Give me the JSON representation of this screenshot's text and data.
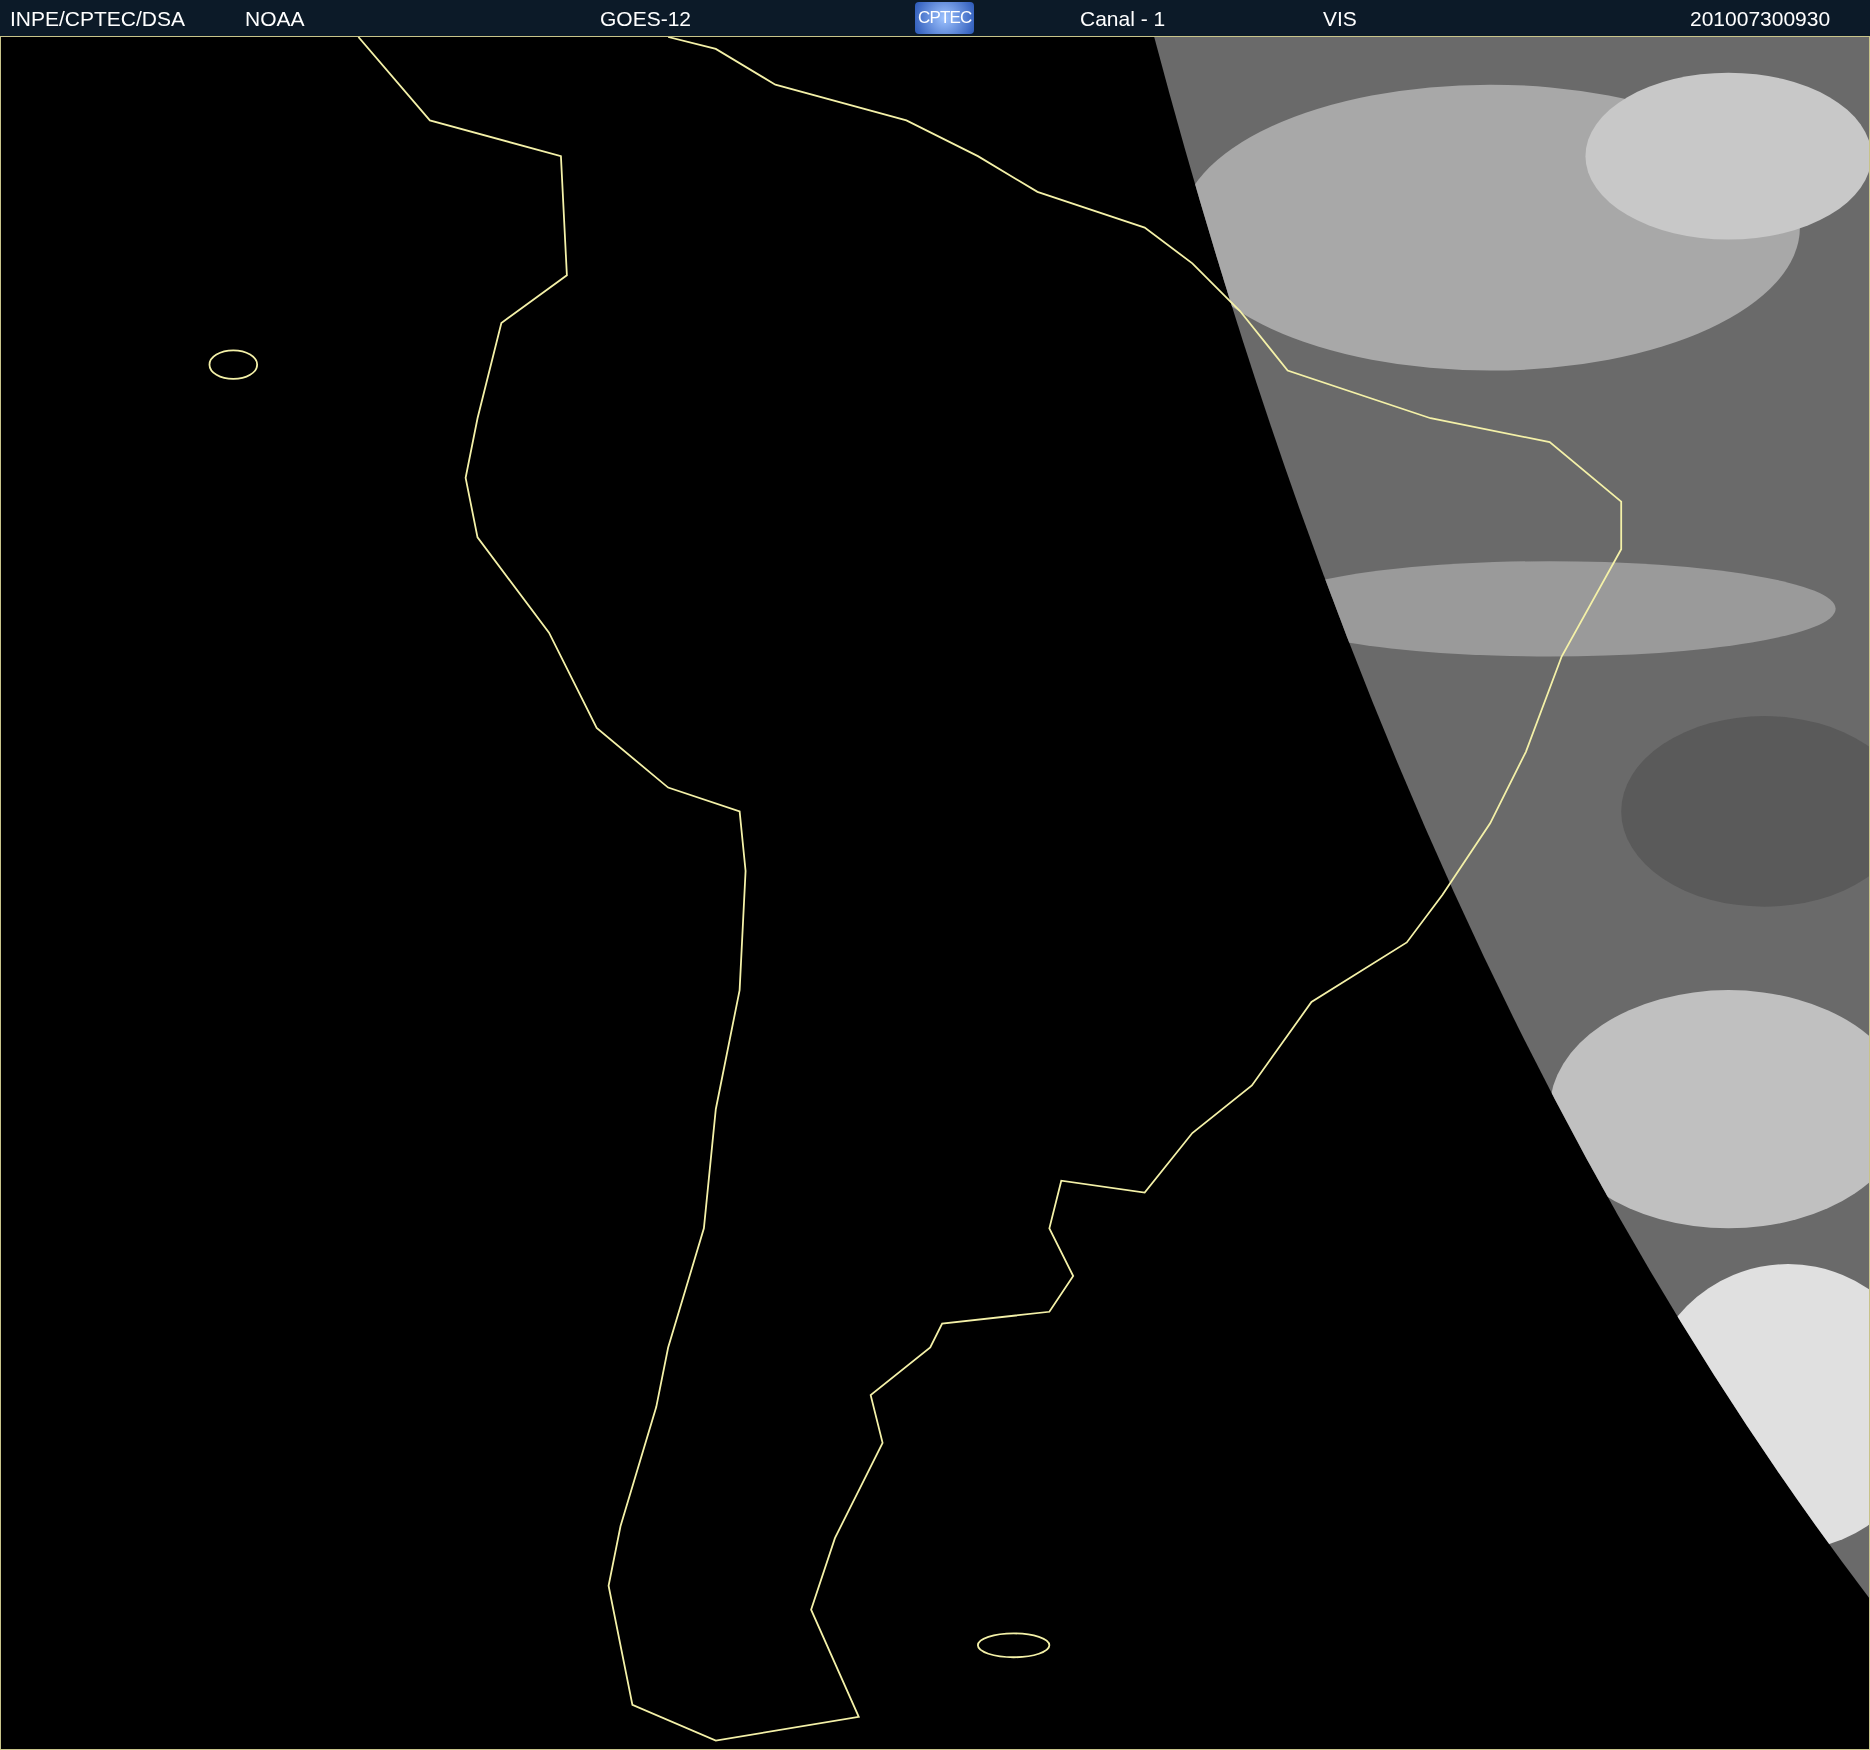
{
  "header": {
    "items": [
      {
        "kind": "text",
        "text": "INPE/CPTEC/DSA"
      },
      {
        "kind": "text",
        "text": "NOAA"
      },
      {
        "kind": "text",
        "text": "GOES-12"
      },
      {
        "kind": "logo",
        "text": "CPTEC"
      },
      {
        "kind": "text",
        "text": "Canal - 1"
      },
      {
        "kind": "text",
        "text": "VIS"
      },
      {
        "kind": "text",
        "text": "201007300930"
      }
    ]
  }
}
